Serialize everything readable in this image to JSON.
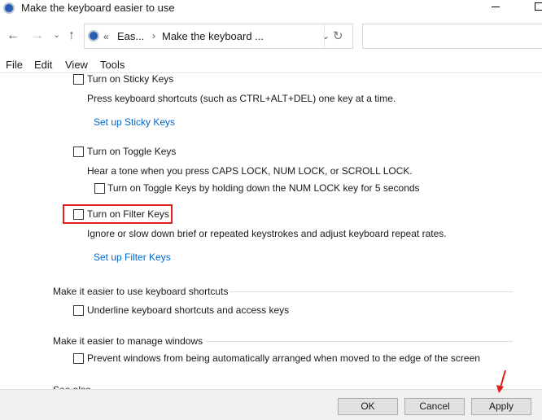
{
  "window": {
    "title": "Make the keyboard easier to use"
  },
  "address": {
    "back": "←",
    "forward": "→",
    "recent": "⌄",
    "up": "↑",
    "prefix": "«",
    "crumb1": "Eas...",
    "sep": "›",
    "crumb2": "Make the keyboard ...",
    "dropdown": "⌄",
    "refresh": "↻",
    "search_placeholder": ""
  },
  "menu": [
    "File",
    "Edit",
    "View",
    "Tools"
  ],
  "content": {
    "sticky": {
      "label": "Turn on Sticky Keys",
      "checked": false,
      "desc": "Press keyboard shortcuts (such as CTRL+ALT+DEL) one key at a time.",
      "link": "Set up Sticky Keys"
    },
    "toggle": {
      "label": "Turn on Toggle Keys",
      "checked": false,
      "desc": "Hear a tone when you press CAPS LOCK, NUM LOCK, or SCROLL LOCK.",
      "sub": "Turn on Toggle Keys by holding down the NUM LOCK key for 5 seconds"
    },
    "filter": {
      "label": "Turn on Filter Keys",
      "checked": false,
      "desc": "Ignore or slow down brief or repeated keystrokes and adjust keyboard repeat rates.",
      "link": "Set up Filter Keys"
    },
    "shortcuts": {
      "heading": "Make it easier to use keyboard shortcuts",
      "option": "Underline keyboard shortcuts and access keys"
    },
    "windows": {
      "heading": "Make it easier to manage windows",
      "option": "Prevent windows from being automatically arranged when moved to the edge of the screen"
    },
    "see_also": "See also"
  },
  "footer": {
    "ok": "OK",
    "cancel": "Cancel",
    "apply": "Apply"
  },
  "colors": {
    "highlight": "#e01e1e",
    "link": "#0066cc",
    "footer_bg": "#f0f0f0"
  }
}
